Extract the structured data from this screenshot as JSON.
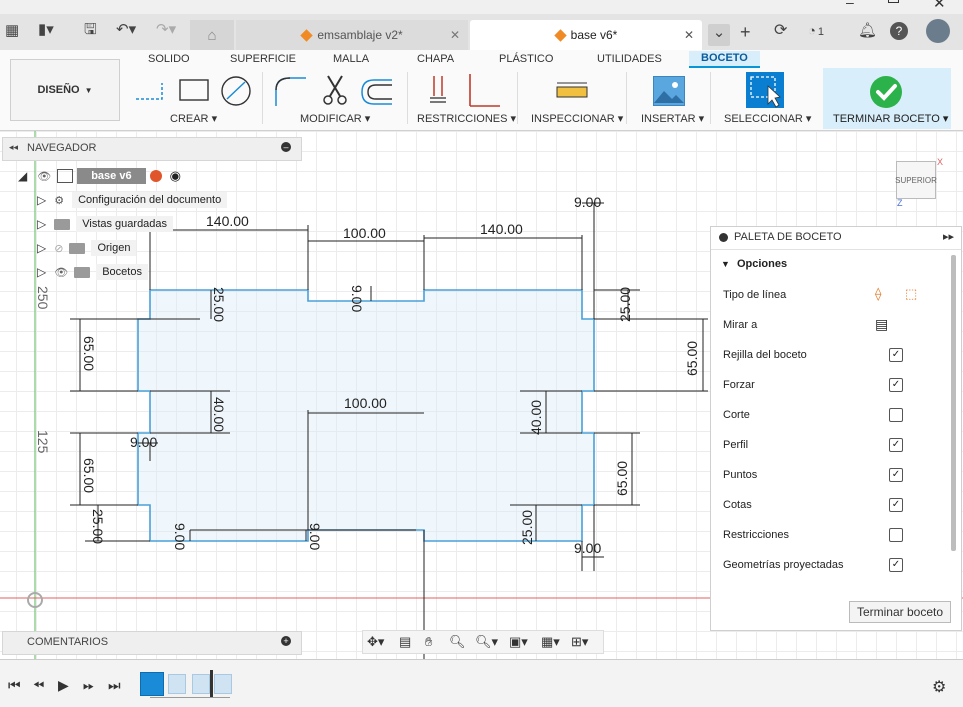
{
  "window": {
    "minimize_icon": "minimize-icon",
    "maximize_icon": "maximize-icon",
    "close_icon": "close-icon"
  },
  "tabs": [
    {
      "label": "emsamblaje v2*",
      "active": false
    },
    {
      "label": "base v6*",
      "active": true
    }
  ],
  "toolbar": {
    "notifications_count": "1"
  },
  "ribbon": {
    "workspace": "DISEÑO",
    "tabs": [
      "SOLIDO",
      "SUPERFICIE",
      "MALLA",
      "CHAPA",
      "PLÁSTICO",
      "UTILIDADES",
      "BOCETO"
    ],
    "groups": [
      "CREAR",
      "MODIFICAR",
      "RESTRICCIONES",
      "INSPECCIONAR",
      "INSERTAR",
      "SELECCIONAR",
      "TERMINAR BOCETO"
    ]
  },
  "navigator": {
    "title": "NAVEGADOR",
    "root": "base v6",
    "items": [
      "Configuración del documento",
      "Vistas guardadas",
      "Origen",
      "Bocetos"
    ]
  },
  "viewcube": {
    "label": "SUPERIOR",
    "axis_x": "X",
    "axis_z": "Z"
  },
  "palette": {
    "title": "PALETA DE BOCETO",
    "section": "Opciones",
    "rows": [
      {
        "label": "Tipo de línea",
        "type": "icons"
      },
      {
        "label": "Mirar a",
        "type": "icon"
      },
      {
        "label": "Rejilla del boceto",
        "checked": true
      },
      {
        "label": "Forzar",
        "checked": true
      },
      {
        "label": "Corte",
        "checked": false
      },
      {
        "label": "Perfil",
        "checked": true
      },
      {
        "label": "Puntos",
        "checked": true
      },
      {
        "label": "Cotas",
        "checked": true
      },
      {
        "label": "Restricciones",
        "checked": false
      },
      {
        "label": "Geometrías proyectadas",
        "checked": true
      }
    ],
    "finish_button": "Terminar boceto"
  },
  "comments": {
    "title": "COMENTARIOS"
  },
  "dimensions": {
    "d140a": "140.00",
    "d100a": "100.00",
    "d140b": "140.00",
    "d9a": "9.00",
    "d9b": "9.00",
    "d25a": "25.00",
    "d25b": "25.00",
    "d65a": "65.00",
    "d65b": "65.00",
    "d40a": "40.00",
    "d40b": "40.00",
    "d100b": "100.00",
    "d9c": "9.00",
    "d65c": "65.00",
    "d65d": "65.00",
    "d25c": "25.00",
    "d9d": "9.00",
    "d9e": "9.00",
    "d25d": "25.00",
    "d9f": "9.00",
    "d250": "250",
    "d125": "125"
  }
}
